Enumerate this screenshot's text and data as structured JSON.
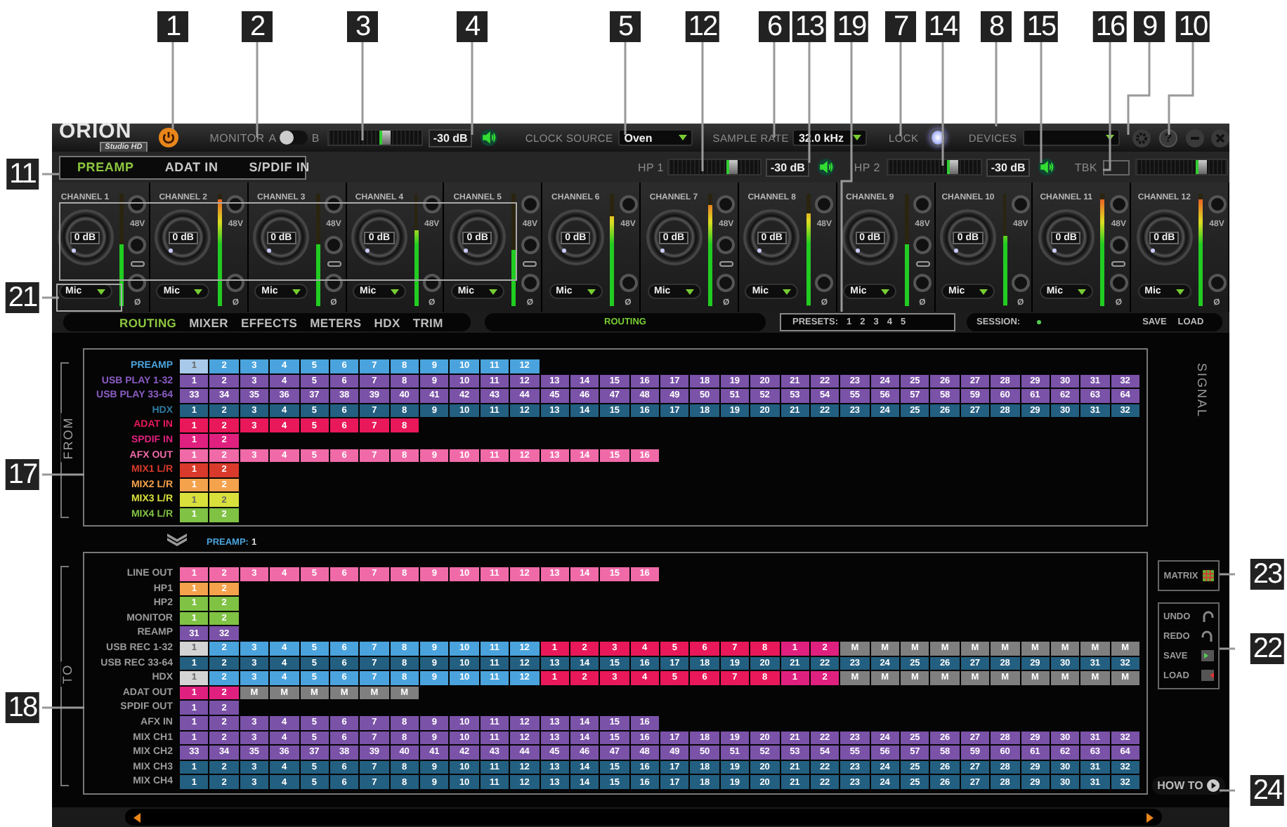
{
  "callouts": [
    "1",
    "2",
    "3",
    "4",
    "5",
    "12",
    "6",
    "13",
    "19",
    "7",
    "14",
    "8",
    "15",
    "16",
    "9",
    "10",
    "11",
    "21",
    "17",
    "18",
    "23",
    "22",
    "24"
  ],
  "app": {
    "logo": {
      "name": "ORION",
      "sub": "Studio HD"
    },
    "monitor": {
      "label": "MONITOR",
      "a": "A",
      "b": "B",
      "on": false
    },
    "main_volume": {
      "level": 0.62,
      "reading": "-30 dB"
    },
    "clock_source": {
      "label": "CLOCK SOURCE",
      "value": "Oven"
    },
    "sample_rate": {
      "label": "SAMPLE RATE",
      "value": "32.0 kHz"
    },
    "lock": {
      "label": "LOCK",
      "on": true
    },
    "devices": {
      "label": "DEVICES"
    },
    "help": "?",
    "input_tabs": [
      {
        "label": "PREAMP",
        "selected": true
      },
      {
        "label": "ADAT IN",
        "selected": false
      },
      {
        "label": "S/PDIF IN",
        "selected": false
      }
    ],
    "hp1": {
      "label": "HP 1",
      "level": 0.72,
      "reading": "-30 dB"
    },
    "hp2": {
      "label": "HP 2",
      "level": 0.72,
      "reading": "-30 dB"
    },
    "talkback": {
      "label": "TBK",
      "level": 0.75
    },
    "channels": [
      {
        "name": "CHANNEL 1",
        "gain": "0 dB",
        "input": "Mic",
        "phantom": "48V",
        "phase": "Ø",
        "linked": true,
        "level": 0.55
      },
      {
        "name": "CHANNEL 2",
        "gain": "0 dB",
        "input": "Mic",
        "phantom": "48V",
        "phase": "Ø",
        "linked": false,
        "level": 0.95
      },
      {
        "name": "CHANNEL 3",
        "gain": "0 dB",
        "input": "Mic",
        "phantom": "48V",
        "phase": "Ø",
        "linked": true,
        "level": 0.55
      },
      {
        "name": "CHANNEL 4",
        "gain": "0 dB",
        "input": "Mic",
        "phantom": "48V",
        "phase": "Ø",
        "linked": false,
        "level": 0.68
      },
      {
        "name": "CHANNEL 5",
        "gain": "0 dB",
        "input": "Mic",
        "phantom": "48V",
        "phase": "Ø",
        "linked": true,
        "level": 0.5
      },
      {
        "name": "CHANNEL 6",
        "gain": "0 dB",
        "input": "Mic",
        "phantom": "48V",
        "phase": "Ø",
        "linked": false,
        "level": 0.8
      },
      {
        "name": "CHANNEL 7",
        "gain": "0 dB",
        "input": "Mic",
        "phantom": "48V",
        "phase": "Ø",
        "linked": true,
        "level": 0.9
      },
      {
        "name": "CHANNEL 8",
        "gain": "0 dB",
        "input": "Mic",
        "phantom": "48V",
        "phase": "Ø",
        "linked": false,
        "level": 0.82
      },
      {
        "name": "CHANNEL 9",
        "gain": "0 dB",
        "input": "Mic",
        "phantom": "48V",
        "phase": "Ø",
        "linked": true,
        "level": 0.55
      },
      {
        "name": "CHANNEL 10",
        "gain": "0 dB",
        "input": "Mic",
        "phantom": "48V",
        "phase": "Ø",
        "linked": false,
        "level": 0.62
      },
      {
        "name": "CHANNEL 11",
        "gain": "0 dB",
        "input": "Mic",
        "phantom": "48V",
        "phase": "Ø",
        "linked": true,
        "level": 0.95
      },
      {
        "name": "CHANNEL 12",
        "gain": "0 dB",
        "input": "Mic",
        "phantom": "48V",
        "phase": "Ø",
        "linked": false,
        "level": 0.95
      }
    ],
    "nav_tabs": [
      {
        "label": "ROUTING",
        "selected": true
      },
      {
        "label": "MIXER",
        "selected": false
      },
      {
        "label": "EFFECTS",
        "selected": false
      },
      {
        "label": "METERS",
        "selected": false
      },
      {
        "label": "HDX",
        "selected": false
      },
      {
        "label": "TRIM",
        "selected": false
      }
    ],
    "view_title": "ROUTING",
    "presets": {
      "label": "PRESETS:",
      "items": [
        "1",
        "2",
        "3",
        "4",
        "5"
      ]
    },
    "session": {
      "label": "SESSION:",
      "save": "SAVE",
      "load": "LOAD"
    },
    "matrix": {
      "from_label": "FROM",
      "signal_label": "SIGNAL",
      "to_label": "TO",
      "from_rows": [
        {
          "label": "PREAMP",
          "color": "#4aa3dc",
          "segments": [
            {
              "color": "#a9c9ea",
              "cells": [
                "1"
              ]
            },
            {
              "color": "#4aa3dc",
              "cells": [
                "2",
                "3",
                "4",
                "5",
                "6",
                "7",
                "8",
                "9",
                "10",
                "11",
                "12"
              ]
            }
          ]
        },
        {
          "label": "USB PLAY 1-32",
          "color": "#8b5cc4",
          "segments": [
            {
              "color": "#7a52a8",
              "cells": [
                "1",
                "2",
                "3",
                "4",
                "5",
                "6",
                "7",
                "8",
                "9",
                "10",
                "11",
                "12",
                "13",
                "14",
                "15",
                "16",
                "17",
                "18",
                "19",
                "20",
                "21",
                "22",
                "23",
                "24",
                "25",
                "26",
                "27",
                "28",
                "29",
                "30",
                "31",
                "32"
              ]
            }
          ]
        },
        {
          "label": "USB PLAY 33-64",
          "color": "#8b5cc4",
          "segments": [
            {
              "color": "#7a52a8",
              "cells": [
                "33",
                "34",
                "35",
                "36",
                "37",
                "38",
                "39",
                "40",
                "41",
                "42",
                "43",
                "44",
                "45",
                "46",
                "47",
                "48",
                "49",
                "50",
                "51",
                "52",
                "53",
                "54",
                "55",
                "56",
                "57",
                "58",
                "59",
                "60",
                "61",
                "62",
                "63",
                "64"
              ]
            }
          ]
        },
        {
          "label": "HDX",
          "color": "#2e7aa0",
          "segments": [
            {
              "color": "#235f80",
              "cells": [
                "1",
                "2",
                "3",
                "4",
                "5",
                "6",
                "7",
                "8",
                "9",
                "10",
                "11",
                "12",
                "13",
                "14",
                "15",
                "16",
                "17",
                "18",
                "19",
                "20",
                "21",
                "22",
                "23",
                "24",
                "25",
                "26",
                "27",
                "28",
                "29",
                "30",
                "31",
                "32"
              ]
            }
          ]
        },
        {
          "label": "ADAT IN",
          "color": "#e8185a",
          "segments": [
            {
              "color": "#e8185a",
              "cells": [
                "1",
                "2",
                "3",
                "4",
                "5",
                "6",
                "7",
                "8"
              ]
            }
          ]
        },
        {
          "label": "SPDIF IN",
          "color": "#e0207e",
          "segments": [
            {
              "color": "#e0207e",
              "cells": [
                "1",
                "2"
              ]
            }
          ]
        },
        {
          "label": "AFX OUT",
          "color": "#f06aa8",
          "segments": [
            {
              "color": "#f06aa8",
              "cells": [
                "1",
                "2",
                "3",
                "4",
                "5",
                "6",
                "7",
                "8",
                "9",
                "10",
                "11",
                "12",
                "13",
                "14",
                "15",
                "16"
              ]
            }
          ]
        },
        {
          "label": "MIX1 L/R",
          "color": "#d93a2b",
          "segments": [
            {
              "color": "#d93a2b",
              "cells": [
                "1",
                "2"
              ]
            }
          ]
        },
        {
          "label": "MIX2 L/R",
          "color": "#f5a24c",
          "segments": [
            {
              "color": "#f5a24c",
              "cells": [
                "1",
                "2"
              ]
            }
          ]
        },
        {
          "label": "MIX3 L/R",
          "color": "#d9e03c",
          "segments": [
            {
              "color": "#d9e03c",
              "cells": [
                "1",
                "2"
              ]
            }
          ]
        },
        {
          "label": "MIX4 L/R",
          "color": "#7fc244",
          "segments": [
            {
              "color": "#7fc244",
              "cells": [
                "1",
                "2"
              ]
            }
          ]
        }
      ],
      "selection_label": "PREAMP:",
      "selection_value": "1",
      "to_rows": [
        {
          "label": "LINE OUT",
          "segments": [
            {
              "color": "#f06aa8",
              "cells": [
                "1",
                "2",
                "3",
                "4",
                "5",
                "6",
                "7",
                "8",
                "9",
                "10",
                "11",
                "12",
                "13",
                "14",
                "15",
                "16"
              ]
            }
          ]
        },
        {
          "label": "HP1",
          "segments": [
            {
              "color": "#f5a24c",
              "cells": [
                "1",
                "2"
              ]
            }
          ]
        },
        {
          "label": "HP2",
          "segments": [
            {
              "color": "#7fc244",
              "cells": [
                "1",
                "2"
              ]
            }
          ]
        },
        {
          "label": "MONITOR",
          "segments": [
            {
              "color": "#7fc244",
              "cells": [
                "1",
                "2"
              ]
            }
          ]
        },
        {
          "label": "REAMP",
          "segments": [
            {
              "color": "#7a52a8",
              "cells": [
                "31",
                "32"
              ]
            }
          ]
        },
        {
          "label": "USB REC 1-32",
          "segments": [
            {
              "color": "#d4d4d4",
              "cells": [
                "1"
              ]
            },
            {
              "color": "#4aa3dc",
              "cells": [
                "2",
                "3",
                "4",
                "5",
                "6",
                "7",
                "8",
                "9",
                "10",
                "11",
                "12"
              ]
            },
            {
              "color": "#e8185a",
              "cells": [
                "1",
                "2",
                "3",
                "4",
                "5",
                "6",
                "7",
                "8"
              ]
            },
            {
              "color": "#e0207e",
              "cells": [
                "1",
                "2"
              ]
            },
            {
              "color": "#7f7f7f",
              "cells": [
                "M",
                "M",
                "M",
                "M",
                "M",
                "M",
                "M",
                "M",
                "M",
                "M"
              ]
            }
          ]
        },
        {
          "label": "USB REC 33-64",
          "segments": [
            {
              "color": "#235f80",
              "cells": [
                "1",
                "2",
                "3",
                "4",
                "5",
                "6",
                "7",
                "8",
                "9",
                "10",
                "11",
                "12",
                "13",
                "14",
                "15",
                "16",
                "17",
                "18",
                "19",
                "20",
                "21",
                "22",
                "23",
                "24",
                "25",
                "26",
                "27",
                "28",
                "29",
                "30",
                "31",
                "32"
              ]
            }
          ]
        },
        {
          "label": "HDX",
          "segments": [
            {
              "color": "#d4d4d4",
              "cells": [
                "1"
              ]
            },
            {
              "color": "#4aa3dc",
              "cells": [
                "2",
                "3",
                "4",
                "5",
                "6",
                "7",
                "8",
                "9",
                "10",
                "11",
                "12"
              ]
            },
            {
              "color": "#e8185a",
              "cells": [
                "1",
                "2",
                "3",
                "4",
                "5",
                "6",
                "7",
                "8"
              ]
            },
            {
              "color": "#e0207e",
              "cells": [
                "1",
                "2"
              ]
            },
            {
              "color": "#7f7f7f",
              "cells": [
                "M",
                "M",
                "M",
                "M",
                "M",
                "M",
                "M",
                "M",
                "M",
                "M"
              ]
            }
          ]
        },
        {
          "label": "ADAT OUT",
          "segments": [
            {
              "color": "#e0207e",
              "cells": [
                "1",
                "2"
              ]
            },
            {
              "color": "#7f7f7f",
              "cells": [
                "M",
                "M",
                "M",
                "M",
                "M",
                "M"
              ]
            }
          ]
        },
        {
          "label": "SPDIF OUT",
          "segments": [
            {
              "color": "#7a52a8",
              "cells": [
                "1",
                "2"
              ]
            }
          ]
        },
        {
          "label": "AFX IN",
          "segments": [
            {
              "color": "#7a52a8",
              "cells": [
                "1",
                "2",
                "3",
                "4",
                "5",
                "6",
                "7",
                "8",
                "9",
                "10",
                "11",
                "12",
                "13",
                "14",
                "15",
                "16"
              ]
            }
          ]
        },
        {
          "label": "MIX CH1",
          "segments": [
            {
              "color": "#7a52a8",
              "cells": [
                "1",
                "2",
                "3",
                "4",
                "5",
                "6",
                "7",
                "8",
                "9",
                "10",
                "11",
                "12",
                "13",
                "14",
                "15",
                "16",
                "17",
                "18",
                "19",
                "20",
                "21",
                "22",
                "23",
                "24",
                "25",
                "26",
                "27",
                "28",
                "29",
                "30",
                "31",
                "32"
              ]
            }
          ]
        },
        {
          "label": "MIX CH2",
          "segments": [
            {
              "color": "#7a52a8",
              "cells": [
                "33",
                "34",
                "35",
                "36",
                "37",
                "38",
                "39",
                "40",
                "41",
                "42",
                "43",
                "44",
                "45",
                "46",
                "47",
                "48",
                "49",
                "50",
                "51",
                "52",
                "53",
                "54",
                "55",
                "56",
                "57",
                "58",
                "59",
                "60",
                "61",
                "62",
                "63",
                "64"
              ]
            }
          ]
        },
        {
          "label": "MIX CH3",
          "segments": [
            {
              "color": "#235f80",
              "cells": [
                "1",
                "2",
                "3",
                "4",
                "5",
                "6",
                "7",
                "8",
                "9",
                "10",
                "11",
                "12",
                "13",
                "14",
                "15",
                "16",
                "17",
                "18",
                "19",
                "20",
                "21",
                "22",
                "23",
                "24",
                "25",
                "26",
                "27",
                "28",
                "29",
                "30",
                "31",
                "32"
              ]
            }
          ]
        },
        {
          "label": "MIX CH4",
          "segments": [
            {
              "color": "#235f80",
              "cells": [
                "1",
                "2",
                "3",
                "4",
                "5",
                "6",
                "7",
                "8",
                "9",
                "10",
                "11",
                "12",
                "13",
                "14",
                "15",
                "16",
                "17",
                "18",
                "19",
                "20",
                "21",
                "22",
                "23",
                "24",
                "25",
                "26",
                "27",
                "28",
                "29",
                "30",
                "31",
                "32"
              ]
            }
          ]
        }
      ]
    },
    "matrix_button": "MATRIX",
    "history": [
      {
        "kind": "undo",
        "label": "UNDO"
      },
      {
        "kind": "redo",
        "label": "REDO"
      },
      {
        "kind": "save",
        "label": "SAVE"
      },
      {
        "kind": "load",
        "label": "LOAD"
      }
    ],
    "how_to": "HOW TO"
  }
}
